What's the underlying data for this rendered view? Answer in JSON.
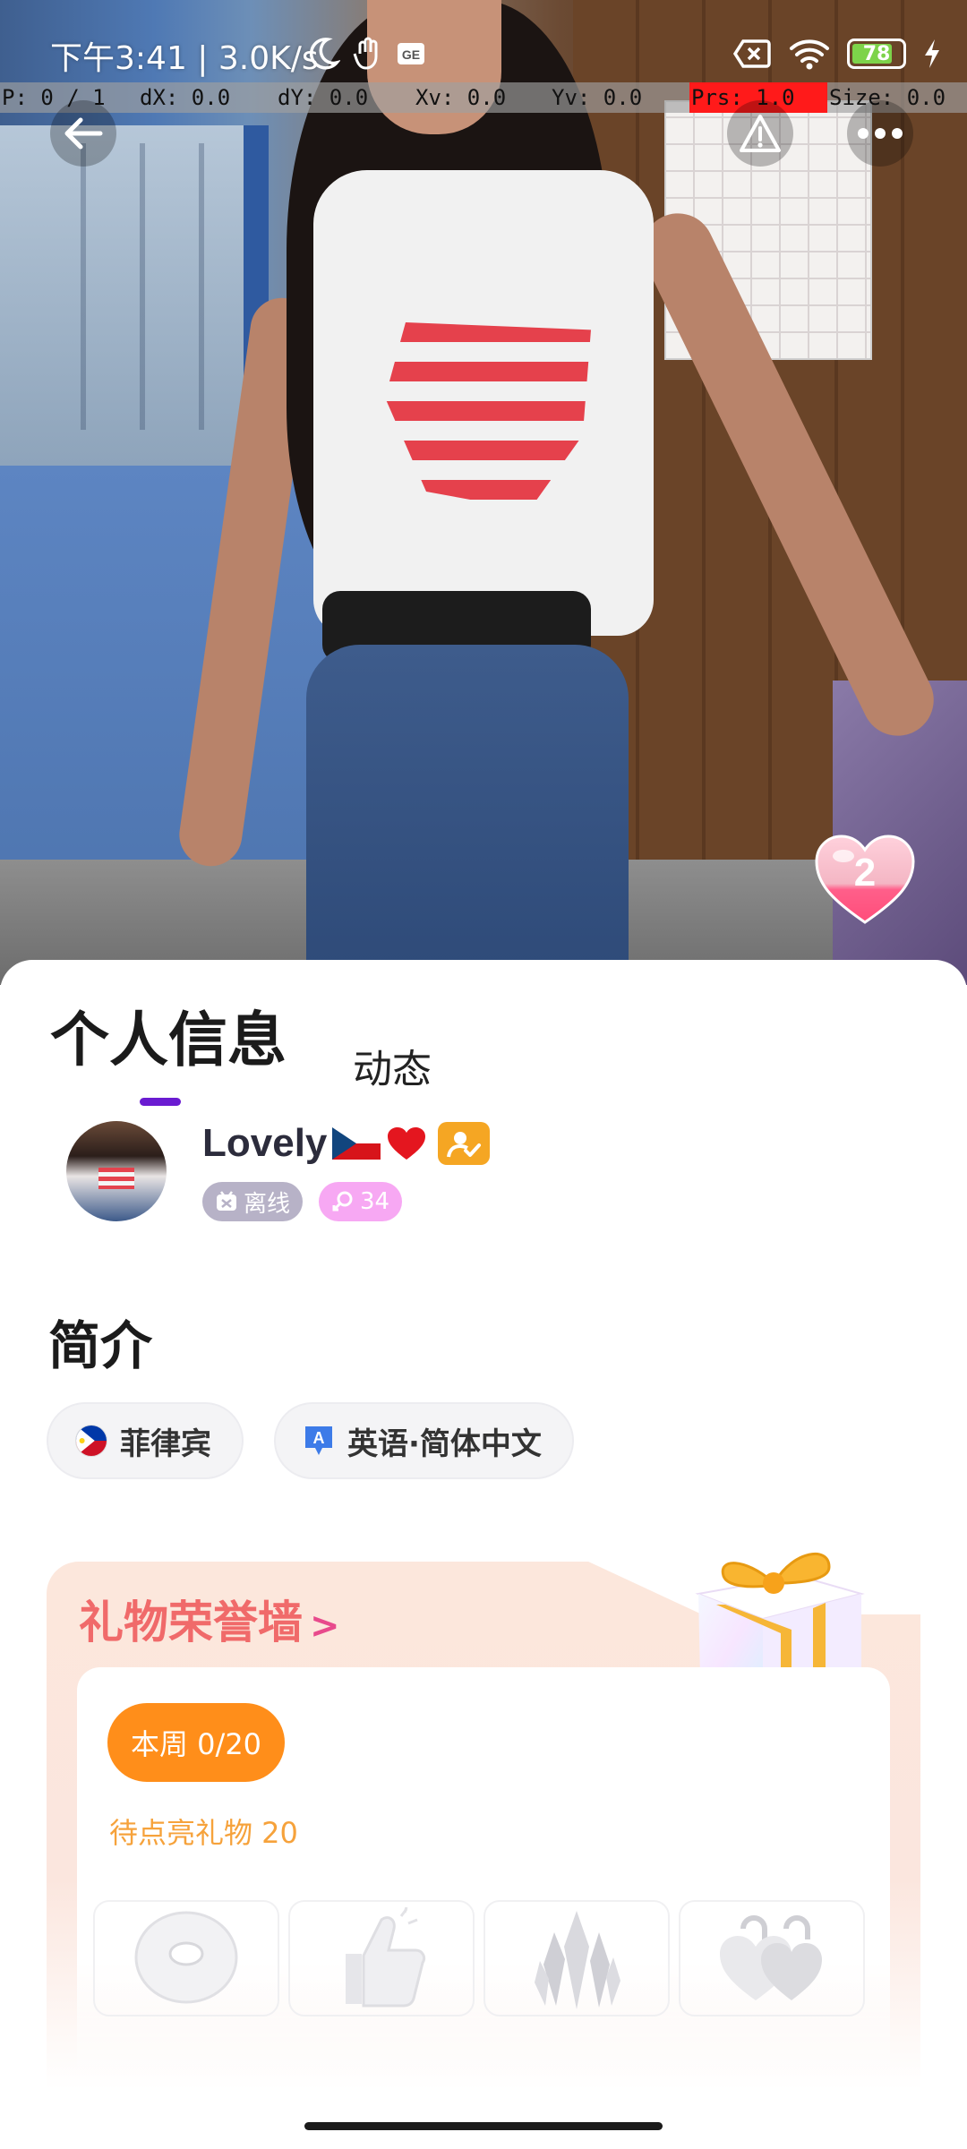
{
  "status_bar": {
    "time_speed": "下午3:41 | 3.0K/s",
    "battery": "78",
    "icons": [
      "moon-icon",
      "hand-icon",
      "gallery-icon",
      "no-sim-icon",
      "wifi-icon",
      "battery-icon",
      "charging-icon"
    ]
  },
  "debug": {
    "pointer": "P: 0 / 1",
    "dx": "dX: 0.0",
    "dy": "dY: 0.0",
    "xv": "Xv: 0.0",
    "yv": "Yv: 0.0",
    "prs": "Prs: 1.0",
    "size": "Size: 0.0"
  },
  "photo": {
    "like_count": "2",
    "icons": [
      "back-arrow-icon",
      "warning-icon",
      "more-icon",
      "heart-icon"
    ]
  },
  "tabs": {
    "active": "个人信息",
    "inactive": "动态"
  },
  "profile": {
    "name": "Lovely",
    "status": "离线",
    "level": "34"
  },
  "intro": {
    "title": "简介",
    "country": "菲律宾",
    "languages": "英语·简体中文"
  },
  "gift_wall": {
    "title": "礼物荣誉墙",
    "chevron": ">",
    "week": "本周 0/20",
    "pending": "待点亮礼物 20",
    "gifts": [
      "donut-icon",
      "thumbs-up-icon",
      "crystal-icon",
      "lock-heart-icon"
    ]
  },
  "colors": {
    "tab_underline": "#6a1bd1",
    "week_pill": "#ff8e1a",
    "gift_title": "#f06a6a",
    "verify_badge": "#f5a623",
    "offline_badge": "#b7b2c7",
    "level_badge": "#f7a8f3"
  }
}
